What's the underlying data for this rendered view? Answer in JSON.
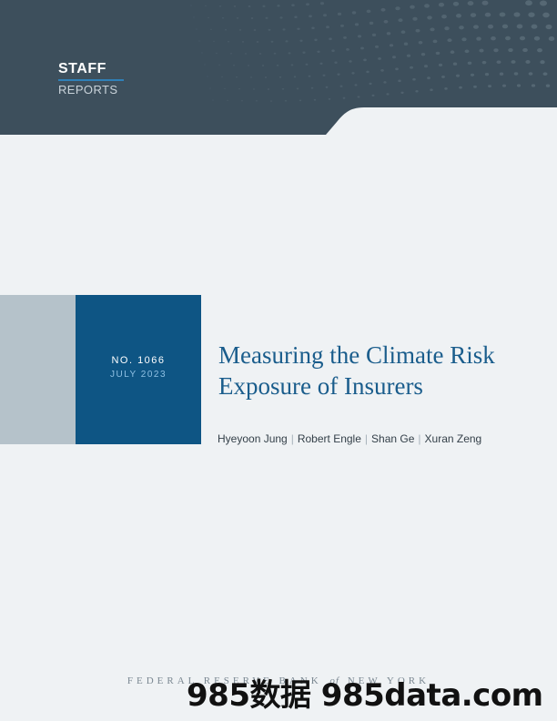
{
  "header": {
    "brand_top": "STAFF",
    "brand_bottom": "REPORTS",
    "colors": {
      "band": "#3d4f5c",
      "dots": "#5a6c78",
      "accent_rule": "#2f80b8"
    }
  },
  "report": {
    "number": "NO. 1066",
    "date": "JULY 2023"
  },
  "title": {
    "line1": "Measuring the Climate Risk",
    "line2": "Exposure of Insurers"
  },
  "authors": [
    "Hyeyoon Jung",
    "Robert Engle",
    "Shan Ge",
    "Xuran Zeng"
  ],
  "footer": {
    "left": "FEDERAL RESERVE BANK",
    "of": "of",
    "right": "NEW YORK"
  },
  "watermark": "985数据 985data.com",
  "colors": {
    "page_bg": "#eff2f4",
    "blue_block": "#0e5584",
    "grey_block": "#b5c2ca",
    "title": "#1a5d8c"
  }
}
